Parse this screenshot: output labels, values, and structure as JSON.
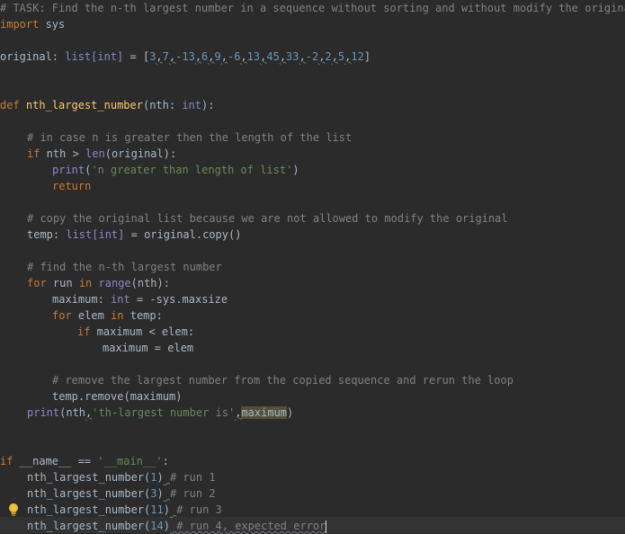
{
  "editor": {
    "theme": {
      "background": "#2b2b2b",
      "keyword": "#cc7832",
      "function": "#ffc66d",
      "comment": "#808080",
      "number": "#6897bb",
      "string": "#6a8759",
      "builtin": "#8888c6",
      "text": "#a9b7c6"
    },
    "line1": {
      "comment": "# TASK: Find the n-th largest number in a sequence without sorting and without modify the original."
    },
    "line2": {
      "kw": "import",
      "rest": " sys"
    },
    "line4": {
      "name": "original",
      "colon": ": ",
      "type": "list[int]",
      "eq": " = [",
      "nums": [
        "3",
        "7",
        "-13",
        "6",
        "9",
        "-6",
        "13",
        "45",
        "33",
        "-2",
        "2",
        "5",
        "12"
      ],
      "close": "]"
    },
    "line7": {
      "kw": "def",
      "name": "nth_largest_number",
      "params": "(nth: ",
      "ptype": "int",
      "close": "):"
    },
    "line9": {
      "comment": "# in case n is greater then the length of the list"
    },
    "line10": {
      "kw": "if",
      "a": " nth > ",
      "fn": "len",
      "b": "(original):"
    },
    "line11": {
      "fn": "print",
      "a": "(",
      "str": "'n greater than length of list'",
      "b": ")"
    },
    "line12": {
      "kw": "return"
    },
    "line14": {
      "comment": "# copy the original list because we are not allowed to modify the original"
    },
    "line15": {
      "a": "temp: ",
      "type": "list[int]",
      "b": " = original.copy()"
    },
    "line17": {
      "comment": "# find the n-th largest number"
    },
    "line18": {
      "kw": "for",
      "a": " run ",
      "kw2": "in",
      "fn": " range",
      "b": "(nth):"
    },
    "line19": {
      "a": "maximum: ",
      "type": "int",
      "b": " = -sys.maxsize"
    },
    "line20": {
      "kw": "for",
      "a": " elem ",
      "kw2": "in",
      "b": " temp:"
    },
    "line21": {
      "kw": "if",
      "a": " maximum < elem:"
    },
    "line22": {
      "a": "maximum = elem"
    },
    "line24": {
      "comment": "# remove the largest number from the copied sequence and rerun the loop"
    },
    "line25": {
      "a": "temp.remove(maximum)"
    },
    "line26": {
      "fn": "print",
      "a": "(nth",
      "comma": ",",
      "str": "'th-largest number is'",
      "comma2": ",",
      "hl": "maximum",
      "b": ")"
    },
    "line29": {
      "kw": "if",
      "a": " __name__ == ",
      "str": "'__main__'",
      "b": ":"
    },
    "calls": [
      {
        "fn": "nth_largest_number",
        "arg": "1",
        "comment": "# run 1"
      },
      {
        "fn": "nth_largest_number",
        "arg": "3",
        "comment": "# run 2"
      },
      {
        "fn": "nth_largest_number",
        "arg": "11",
        "comment": "# run 3"
      },
      {
        "fn": "nth_largest_number",
        "arg": "14",
        "comment": "# run 4, expected error"
      }
    ]
  }
}
